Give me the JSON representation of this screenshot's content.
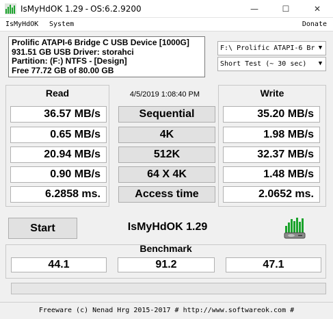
{
  "window": {
    "title_app": "IsMyHdOK 1.29",
    "title_sep": "-",
    "title_os": "OS:6.2.9200",
    "min_glyph": "—",
    "max_glyph": "☐",
    "close_glyph": "✕"
  },
  "menu": {
    "app": "IsMyHdOK",
    "system": "System",
    "donate": "Donate"
  },
  "device": {
    "line1": "Prolific ATAPI-6 Bridge C USB Device [1000G]",
    "line2": "931.51 GB  USB Driver: storahci",
    "line3": "Partition: (F:) NTFS - [Design]",
    "line4": "Free 77.72 GB of 80.00 GB"
  },
  "drive_select": {
    "value": "F:\\ Prolific ATAPI-6 Bri"
  },
  "test_select": {
    "value": "Short Test (~ 30 sec)"
  },
  "arrow_glyph": "▼",
  "read": {
    "header": "Read",
    "sequential": "36.57 MB/s",
    "k4": "0.65 MB/s",
    "k512": "20.94 MB/s",
    "k64x4": "0.90 MB/s",
    "access": "6.2858 ms."
  },
  "write": {
    "header": "Write",
    "sequential": "35.20 MB/s",
    "k4": "1.98 MB/s",
    "k512": "32.37 MB/s",
    "k64x4": "1.48 MB/s",
    "access": "2.0652 ms."
  },
  "timestamp": "4/5/2019 1:08:40 PM",
  "tests": {
    "sequential": "Sequential",
    "k4": "4K",
    "k512": "512K",
    "k64x4": "64 X 4K",
    "access": "Access time"
  },
  "start_label": "Start",
  "version_label": "IsMyHdOK 1.29",
  "benchmark": {
    "header": "Benchmark",
    "read": "44.1",
    "total": "91.2",
    "write": "47.1"
  },
  "progress": {
    "fraction": 0
  },
  "status": "Freeware (c) Nenad Hrg 2015-2017 # http://www.softwareok.com   #",
  "colors": {
    "icon_green": "#1aa32b",
    "icon_disk": "#8a8a8a",
    "progress_fill": "#06b025"
  },
  "icons": {
    "app": "equalizer-bars-icon",
    "bench": "disk-bars-icon"
  }
}
